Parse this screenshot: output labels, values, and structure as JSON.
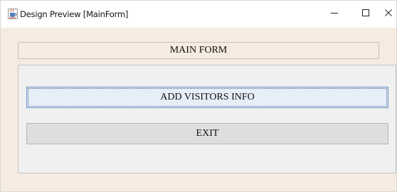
{
  "window": {
    "title": "Design Preview [MainForm]",
    "icon": "java-coffee-cup-icon",
    "controls": {
      "minimize": "–",
      "maximize": "☐",
      "close": "✕"
    }
  },
  "form": {
    "header_label": "MAIN FORM",
    "buttons": {
      "add_visitors_label": "ADD VISITORS INFO",
      "exit_label": "EXIT"
    }
  },
  "colors": {
    "form_background": "#f5ebe1",
    "panel_background": "#f0f0f0",
    "focused_button_background": "#e6eef8",
    "focused_button_border": "#6d94c4",
    "button_background": "#dedede"
  }
}
